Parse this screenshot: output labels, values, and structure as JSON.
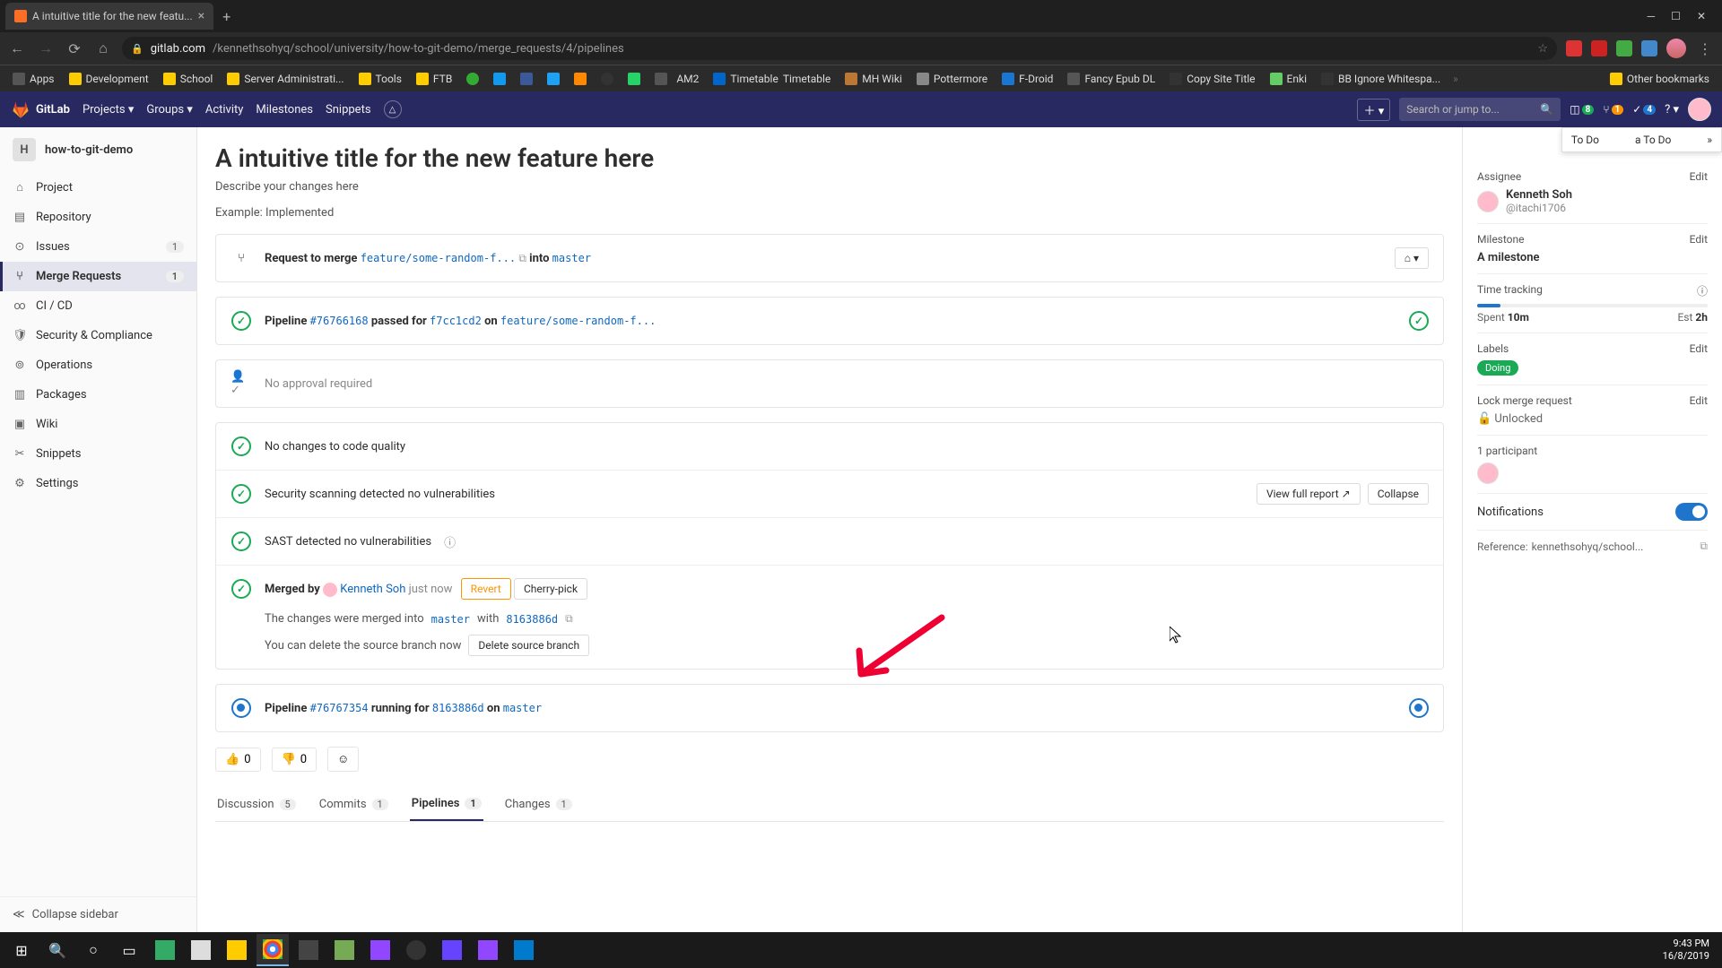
{
  "browser": {
    "tab_title": "A intuitive title for the new featu...",
    "url_host": "gitlab.com",
    "url_path": "/kennethsohyq/school/university/how-to-git-demo/merge_requests/4/pipelines",
    "bookmarks": [
      "Apps",
      "Development",
      "School",
      "Server Administrati...",
      "Tools",
      "FTB",
      "",
      "",
      "",
      "",
      "",
      "",
      "AM2",
      "",
      "Timetable",
      "",
      "MH Wiki",
      "",
      "Pottermore",
      "",
      "F-Droid",
      "",
      "Fancy Epub DL",
      "",
      "Copy Site Title",
      "",
      "Enki",
      "",
      "BB Ignore Whitespa..."
    ],
    "other_bookmarks": "Other bookmarks"
  },
  "gitlab_nav": {
    "brand": "GitLab",
    "projects": "Projects",
    "groups": "Groups",
    "activity": "Activity",
    "milestones": "Milestones",
    "snippets": "Snippets",
    "search_placeholder": "Search or jump to...",
    "issues_count": "8",
    "mr_count": "1",
    "todo_count": "4"
  },
  "sidebar": {
    "project_initial": "H",
    "project_name": "how-to-git-demo",
    "items": [
      {
        "icon": "⌂",
        "label": "Project"
      },
      {
        "icon": "▤",
        "label": "Repository"
      },
      {
        "icon": "⊙",
        "label": "Issues",
        "count": "1"
      },
      {
        "icon": "⑂",
        "label": "Merge Requests",
        "count": "1",
        "active": true
      },
      {
        "icon": "∞",
        "label": "CI / CD"
      },
      {
        "icon": "🛡",
        "label": "Security & Compliance"
      },
      {
        "icon": "⊚",
        "label": "Operations"
      },
      {
        "icon": "▥",
        "label": "Packages"
      },
      {
        "icon": "▣",
        "label": "Wiki"
      },
      {
        "icon": "✂",
        "label": "Snippets"
      },
      {
        "icon": "⚙",
        "label": "Settings"
      }
    ],
    "collapse": "Collapse sidebar"
  },
  "mr": {
    "title": "A intuitive title for the new feature here",
    "desc1": "Describe your changes here",
    "desc2": "Example: Implemented",
    "request_merge": "Request to merge",
    "source_branch": "feature/some-random-f...",
    "into": "into",
    "target_branch": "master",
    "pipeline1_label": "Pipeline",
    "pipeline1_id": "#76766168",
    "pipeline1_status": "passed for",
    "pipeline1_sha": "f7cc1cd2",
    "pipeline1_on": "on",
    "pipeline1_branch": "feature/some-random-f...",
    "approval": "No approval required",
    "code_quality": "No changes to code quality",
    "security": "Security scanning detected no vulnerabilities",
    "view_report": "View full report",
    "collapse_btn": "Collapse",
    "sast": "SAST detected no vulnerabilities",
    "merged_by": "Merged by",
    "merged_user": "Kenneth Soh",
    "merged_time": "just now",
    "revert": "Revert",
    "cherry_pick": "Cherry-pick",
    "merged_into_1": "The changes were merged into",
    "merged_into_branch": "master",
    "merged_into_2": "with",
    "merged_sha": "8163886d",
    "delete_hint": "You can delete the source branch now",
    "delete_btn": "Delete source branch",
    "pipeline2_label": "Pipeline",
    "pipeline2_id": "#76767354",
    "pipeline2_status": "running for",
    "pipeline2_sha": "8163886d",
    "pipeline2_on": "on",
    "pipeline2_branch": "master",
    "thumbs_up": "0",
    "thumbs_down": "0"
  },
  "tabs": {
    "discussion": "Discussion",
    "discussion_n": "5",
    "commits": "Commits",
    "commits_n": "1",
    "pipelines": "Pipelines",
    "pipelines_n": "1",
    "changes": "Changes",
    "changes_n": "1"
  },
  "rside": {
    "todo": "To Do",
    "add_todo": "a To Do",
    "assignee_label": "Assignee",
    "edit": "Edit",
    "assignee_name": "Kenneth Soh",
    "assignee_handle": "@itachi1706",
    "milestone_label": "Milestone",
    "milestone_value": "A milestone",
    "time_label": "Time tracking",
    "spent": "Spent",
    "spent_v": "10m",
    "est": "Est",
    "est_v": "2h",
    "labels_label": "Labels",
    "label_value": "Doing",
    "lock_label": "Lock merge request",
    "lock_value": "Unlocked",
    "participants": "1 participant",
    "notifications": "Notifications",
    "reference_label": "Reference:",
    "reference_value": "kennethsohyq/school..."
  },
  "taskbar": {
    "time": "9:43 PM",
    "date": "16/8/2019"
  }
}
